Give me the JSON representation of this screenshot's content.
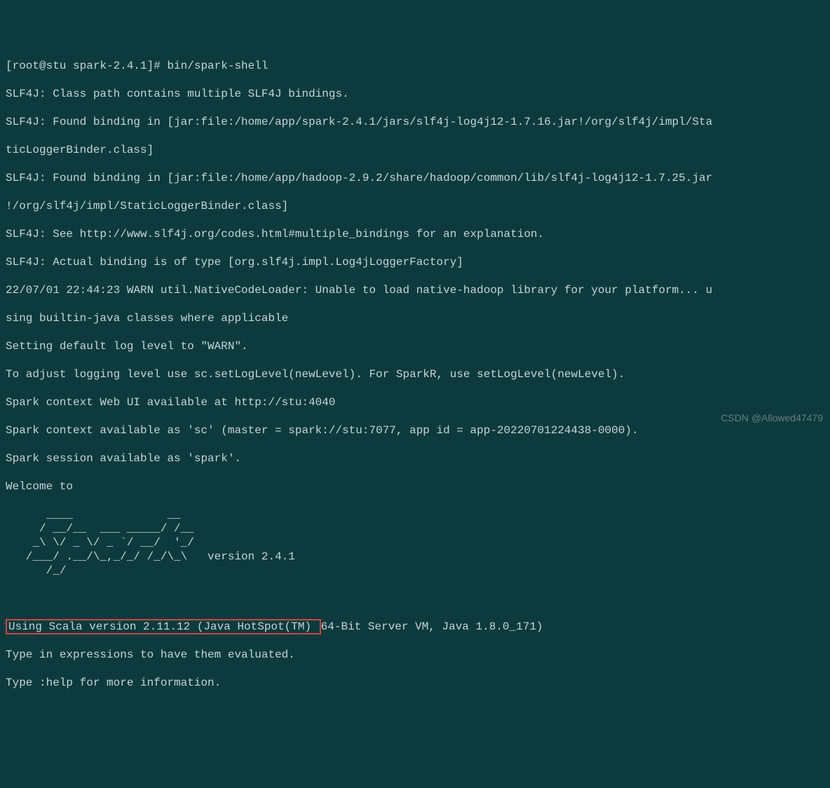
{
  "terminal": {
    "prompt_user": "[root@stu spark-2.4.1]# ",
    "command": "bin/spark-shell",
    "lines": [
      "SLF4J: Class path contains multiple SLF4J bindings.",
      "SLF4J: Found binding in [jar:file:/home/app/spark-2.4.1/jars/slf4j-log4j12-1.7.16.jar!/org/slf4j/impl/Sta",
      "ticLoggerBinder.class]",
      "SLF4J: Found binding in [jar:file:/home/app/hadoop-2.9.2/share/hadoop/common/lib/slf4j-log4j12-1.7.25.jar",
      "!/org/slf4j/impl/StaticLoggerBinder.class]",
      "SLF4J: See http://www.slf4j.org/codes.html#multiple_bindings for an explanation.",
      "SLF4J: Actual binding is of type [org.slf4j.impl.Log4jLoggerFactory]",
      "22/07/01 22:44:23 WARN util.NativeCodeLoader: Unable to load native-hadoop library for your platform... u",
      "sing builtin-java classes where applicable",
      "Setting default log level to \"WARN\".",
      "To adjust logging level use sc.setLogLevel(newLevel). For SparkR, use setLogLevel(newLevel).",
      "Spark context Web UI available at http://stu:4040",
      "Spark context available as 'sc' (master = spark://stu:7077, app id = app-20220701224438-0000).",
      "Spark session available as 'spark'.",
      "Welcome to"
    ],
    "ascii_art": "      ____              __\n     / __/__  ___ _____/ /__\n    _\\ \\/ _ \\/ _ `/ __/  '_/\n   /___/ .__/\\_,_/_/ /_/\\_\\   version 2.4.1\n      /_/",
    "scala_version_highlighted": "Using Scala version 2.11.12 (Java HotSpot(TM) ",
    "scala_version_rest": "64-Bit Server VM, Java 1.8.0_171)",
    "footer_lines": [
      "Type in expressions to have them evaluated.",
      "Type :help for more information."
    ]
  },
  "watermark": "CSDN @Allowed47479"
}
